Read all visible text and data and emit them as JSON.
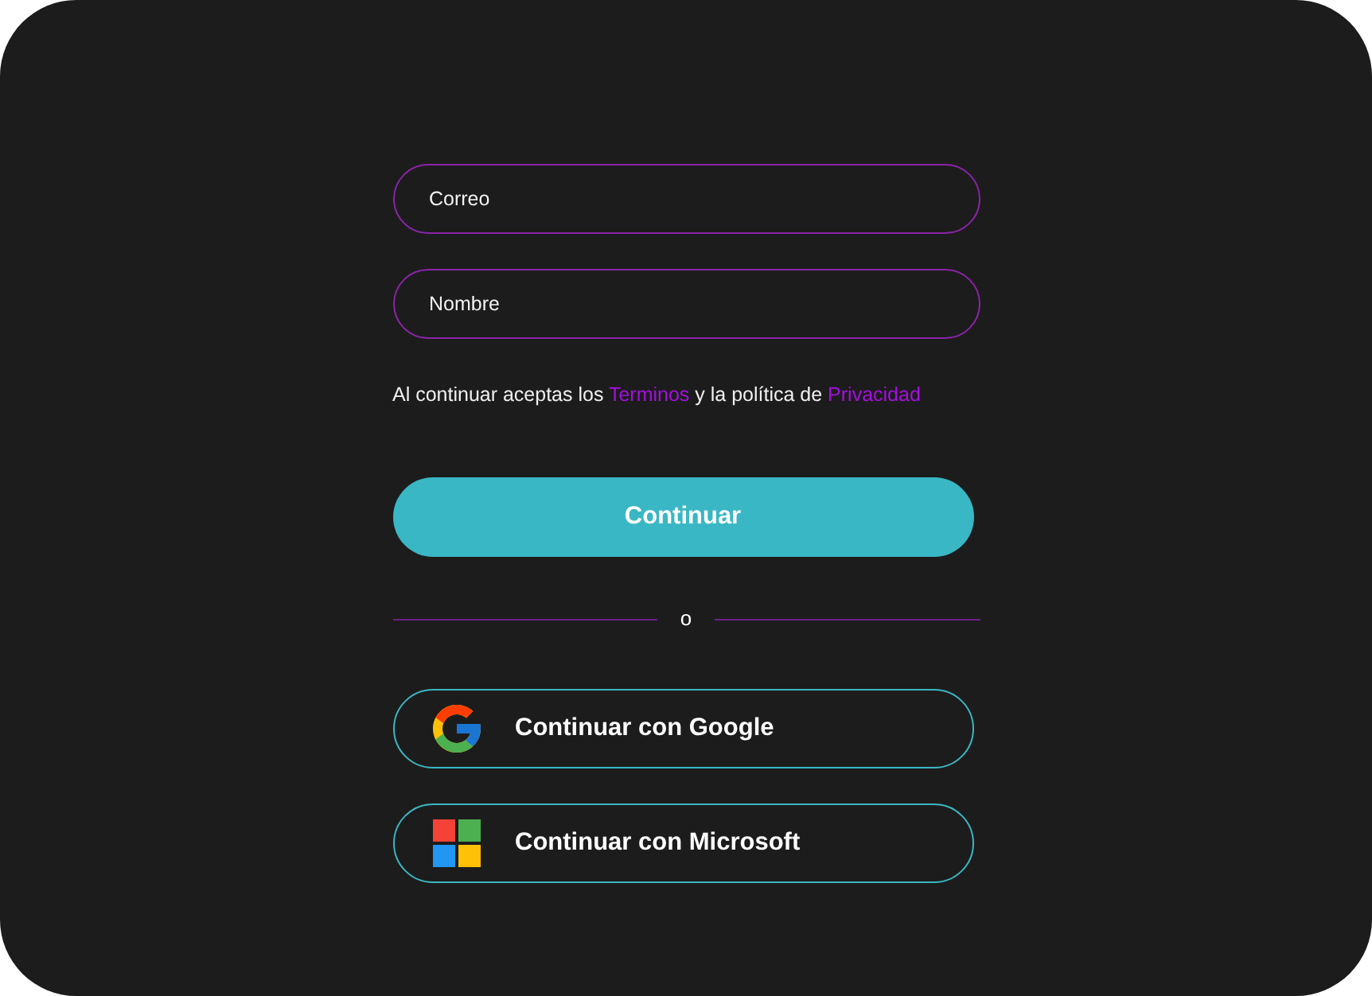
{
  "fields": [
    {
      "placeholder": "Correo"
    },
    {
      "placeholder": "Nombre"
    }
  ],
  "terms": [
    {
      "kind": "text",
      "text": "Al continuar aceptas los "
    },
    {
      "kind": "link",
      "text": "Terminos"
    },
    {
      "kind": "text",
      "text": " y la política de "
    },
    {
      "kind": "link",
      "text": "Privacidad"
    }
  ],
  "primary_button": {
    "label": "Continuar"
  },
  "divider": {
    "label": "o"
  },
  "social_buttons": [
    {
      "kind": "google",
      "label": "Continuar con Google"
    },
    {
      "kind": "microsoft",
      "label": "Continuar con Microsoft"
    }
  ]
}
